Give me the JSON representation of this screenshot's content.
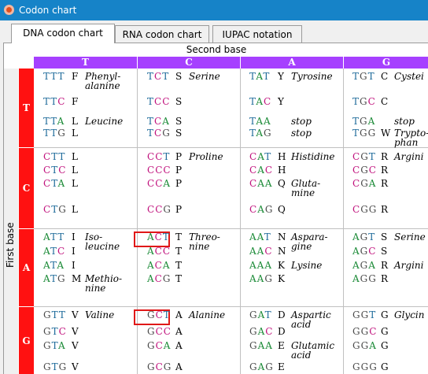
{
  "window": {
    "title": "Codon chart",
    "icon": "app-icon"
  },
  "tabs": [
    {
      "label": "DNA codon chart",
      "active": true
    },
    {
      "label": "RNA codon chart",
      "active": false
    },
    {
      "label": "IUPAC notation",
      "active": false
    }
  ],
  "chart": {
    "second_base_label": "Second base",
    "first_base_label": "First base",
    "second_bases": [
      "T",
      "C",
      "A",
      "G"
    ],
    "first_bases": [
      "T",
      "C",
      "A",
      "G"
    ],
    "blocks": [
      [
        [
          [
            "TTT",
            "F",
            "Phenyl-\nalanine"
          ],
          [
            "TTC",
            "F",
            ""
          ],
          [
            "TTA",
            "L",
            "Leucine"
          ],
          [
            "TTG",
            "L",
            ""
          ]
        ],
        [
          [
            "TCT",
            "S",
            "Serine"
          ],
          [
            "TCC",
            "S",
            ""
          ],
          [
            "TCA",
            "S",
            ""
          ],
          [
            "TCG",
            "S",
            ""
          ]
        ],
        [
          [
            "TAT",
            "Y",
            "Tyrosine"
          ],
          [
            "TAC",
            "Y",
            ""
          ],
          [
            "TAA",
            "",
            "stop"
          ],
          [
            "TAG",
            "",
            "stop"
          ]
        ],
        [
          [
            "TGT",
            "C",
            "Cystei"
          ],
          [
            "TGC",
            "C",
            ""
          ],
          [
            "TGA",
            "",
            "stop"
          ],
          [
            "TGG",
            "W",
            "Trypto-\nphan"
          ]
        ]
      ],
      [
        [
          [
            "CTT",
            "L",
            ""
          ],
          [
            "CTC",
            "L",
            ""
          ],
          [
            "CTA",
            "L",
            ""
          ],
          [
            "CTG",
            "L",
            ""
          ]
        ],
        [
          [
            "CCT",
            "P",
            "Proline"
          ],
          [
            "CCC",
            "P",
            ""
          ],
          [
            "CCA",
            "P",
            ""
          ],
          [
            "CCG",
            "P",
            ""
          ]
        ],
        [
          [
            "CAT",
            "H",
            "Histidine"
          ],
          [
            "CAC",
            "H",
            ""
          ],
          [
            "CAA",
            "Q",
            "Gluta-\nmine"
          ],
          [
            "CAG",
            "Q",
            ""
          ]
        ],
        [
          [
            "CGT",
            "R",
            "Argini"
          ],
          [
            "CGC",
            "R",
            ""
          ],
          [
            "CGA",
            "R",
            ""
          ],
          [
            "CGG",
            "R",
            ""
          ]
        ]
      ],
      [
        [
          [
            "ATT",
            "I",
            "Iso-\nleucine"
          ],
          [
            "ATC",
            "I",
            ""
          ],
          [
            "ATA",
            "I",
            ""
          ],
          [
            "ATG",
            "M",
            "Methio-\nnine"
          ]
        ],
        [
          [
            "ACT",
            "T",
            "Threo-\nnine"
          ],
          [
            "ACC",
            "T",
            ""
          ],
          [
            "ACA",
            "T",
            ""
          ],
          [
            "ACG",
            "T",
            ""
          ]
        ],
        [
          [
            "AAT",
            "N",
            "Aspara-\ngine"
          ],
          [
            "AAC",
            "N",
            ""
          ],
          [
            "AAA",
            "K",
            "Lysine"
          ],
          [
            "AAG",
            "K",
            ""
          ]
        ],
        [
          [
            "AGT",
            "S",
            "Serine"
          ],
          [
            "AGC",
            "S",
            ""
          ],
          [
            "AGA",
            "R",
            "Argini"
          ],
          [
            "AGG",
            "R",
            ""
          ]
        ]
      ],
      [
        [
          [
            "GTT",
            "V",
            "Valine"
          ],
          [
            "GTC",
            "V",
            ""
          ],
          [
            "GTA",
            "V",
            ""
          ],
          [
            "GTG",
            "V",
            ""
          ]
        ],
        [
          [
            "GCT",
            "A",
            "Alanine"
          ],
          [
            "GCC",
            "A",
            ""
          ],
          [
            "GCA",
            "A",
            ""
          ],
          [
            "GCG",
            "A",
            ""
          ]
        ],
        [
          [
            "GAT",
            "D",
            "Aspartic\nacid"
          ],
          [
            "GAC",
            "D",
            ""
          ],
          [
            "GAA",
            "E",
            "Glutamic\nacid"
          ],
          [
            "GAG",
            "E",
            ""
          ]
        ],
        [
          [
            "GGT",
            "G",
            "Glycin"
          ],
          [
            "GGC",
            "G",
            ""
          ],
          [
            "GGA",
            "G",
            ""
          ],
          [
            "GGG",
            "G",
            ""
          ]
        ]
      ]
    ],
    "highlighted_codons": [
      "ACT",
      "GCT"
    ],
    "nucleotide_colors": {
      "T": "#1d6a9a",
      "C": "#c0107c",
      "A": "#1a8a36",
      "G": "#4a4a4a"
    },
    "header_color": "#a640ff",
    "first_base_color": "#ff1111",
    "highlight_color": "#e01818"
  }
}
